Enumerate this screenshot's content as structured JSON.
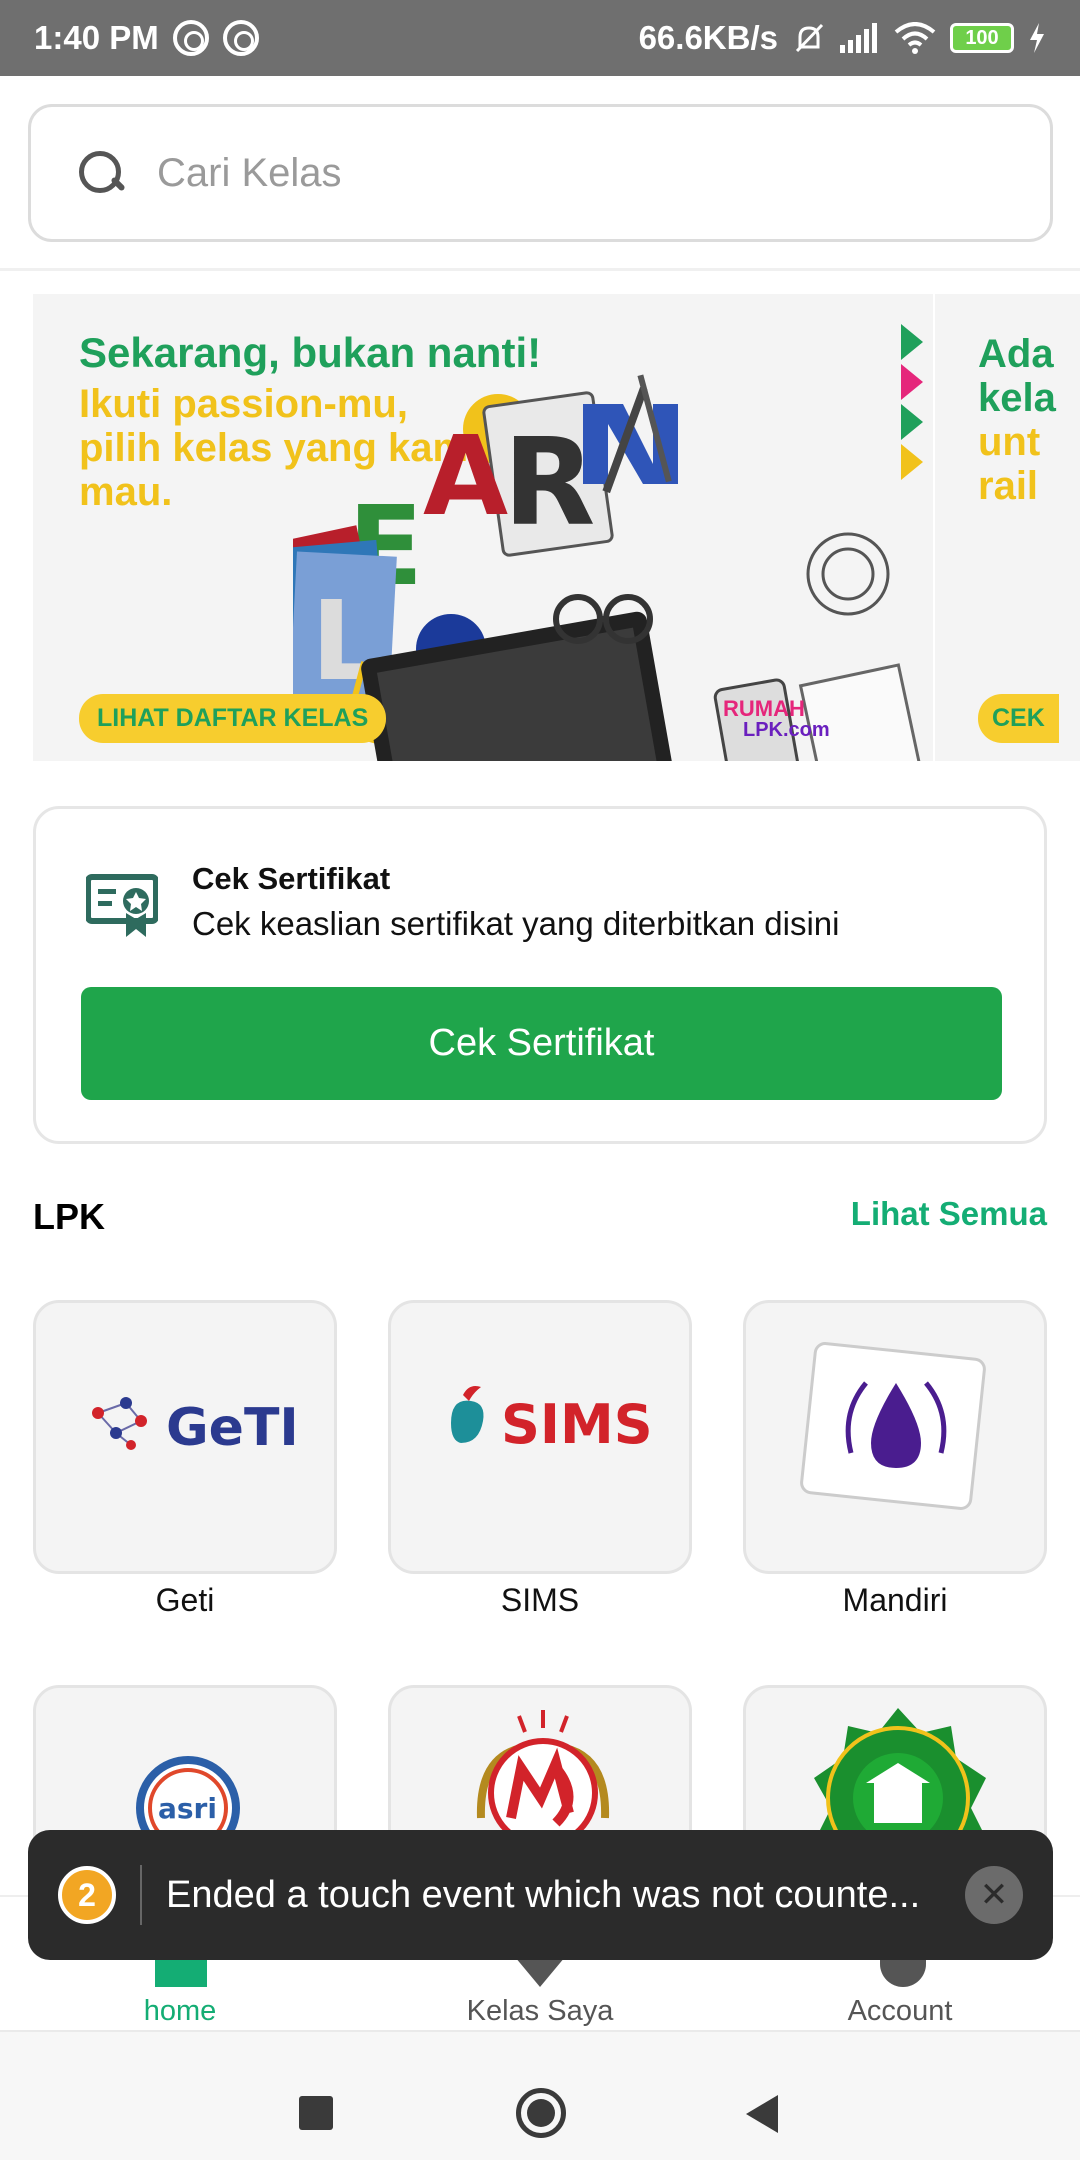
{
  "status_bar": {
    "time": "1:40 PM",
    "network_speed": "66.6KB/s",
    "battery": "100"
  },
  "search": {
    "placeholder": "Cari Kelas"
  },
  "banner": {
    "headline": "Sekarang, bukan nanti!",
    "subline": "Ikuti passion-mu, pilih kelas yang kamu mau.",
    "cta": "LIHAT DAFTAR KELAS",
    "brand_line1": "RUMAH",
    "brand_line2": "LPK.com",
    "art_word": "LEARN"
  },
  "banner_next": {
    "text": "Ada kela unt rail",
    "cta": "CEK"
  },
  "certificate": {
    "title": "Cek Sertifikat",
    "description": "Cek keaslian sertifikat yang diterbitkan disini",
    "button_label": "Cek Sertifikat"
  },
  "lpk": {
    "title": "LPK",
    "see_all": "Lihat Semua",
    "items": [
      {
        "name": "Geti",
        "logo_text": "GeTI"
      },
      {
        "name": "SIMS",
        "logo_text": "SIMS"
      },
      {
        "name": "Mandiri",
        "logo_text": ""
      },
      {
        "name": "",
        "logo_text": "asri"
      },
      {
        "name": "",
        "logo_text": ""
      },
      {
        "name": "",
        "logo_text": ""
      }
    ]
  },
  "bottom_nav": {
    "items": [
      {
        "label": "home",
        "icon": "home-icon",
        "active": true
      },
      {
        "label": "Kelas Saya",
        "icon": "class-icon",
        "active": false
      },
      {
        "label": "Account",
        "icon": "account-icon",
        "active": false
      }
    ]
  },
  "toast": {
    "count": "2",
    "message": "Ended a touch event which was not counte..."
  },
  "colors": {
    "primary_green": "#1fa54b",
    "accent_teal": "#14ad74",
    "banner_yellow": "#f1c21b"
  }
}
